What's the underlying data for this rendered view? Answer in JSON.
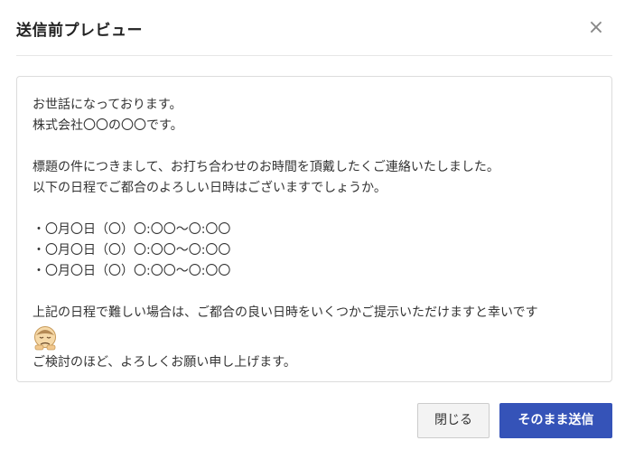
{
  "dialog": {
    "title": "送信前プレビュー",
    "close_icon": "×"
  },
  "preview": {
    "lines": [
      "お世話になっております。",
      "株式会社〇〇の〇〇です。",
      "",
      "標題の件につきまして、お打ち合わせのお時間を頂戴したくご連絡いたしました。",
      "以下の日程でご都合のよろしい日時はございますでしょうか。",
      "",
      "・〇月〇日（〇）〇:〇〇〜〇:〇〇",
      "・〇月〇日（〇）〇:〇〇〜〇:〇〇",
      "・〇月〇日（〇）〇:〇〇〜〇:〇〇",
      "",
      "上記の日程で難しい場合は、ご都合の良い日時をいくつかご提示いただけますと幸いです",
      "ご検討のほど、よろしくお願い申し上げます。"
    ],
    "emoji_icon": "bowing-face-emoji"
  },
  "footer": {
    "close_label": "閉じる",
    "send_label": "そのまま送信",
    "send_color": "#3553b8"
  }
}
